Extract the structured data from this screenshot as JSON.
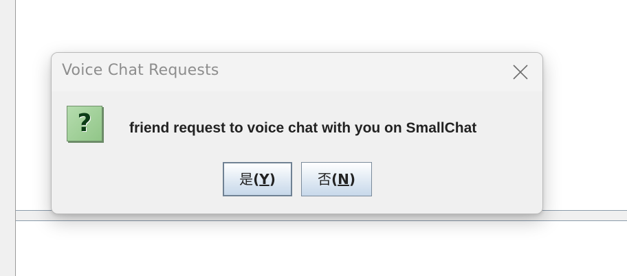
{
  "dialog": {
    "title": "Voice Chat Requests",
    "message": "friend request to voice chat with you on SmallChat",
    "icon": {
      "name": "question-icon",
      "glyph": "?"
    },
    "close_icon": "close-icon",
    "buttons": {
      "yes": {
        "label": "是",
        "paren_open": "(",
        "mnemonic": "Y",
        "paren_close": ")"
      },
      "no": {
        "label": "否",
        "paren_open": "(",
        "mnemonic": "N",
        "paren_close": ")"
      }
    }
  },
  "colors": {
    "dialog_bg": "#f0f0f0",
    "title_text": "#8d8d8d",
    "message_text": "#222222",
    "icon_green": "#a6d39d",
    "button_gradient_bottom": "#c7d8ea"
  }
}
